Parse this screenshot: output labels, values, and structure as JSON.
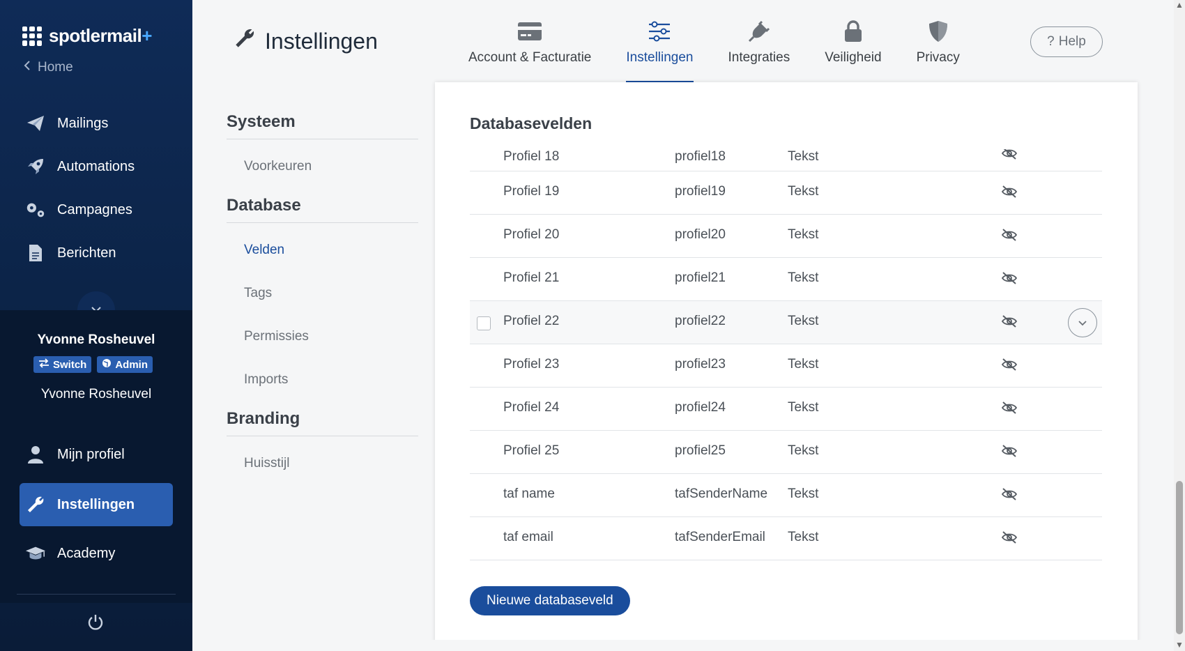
{
  "brand": {
    "name": "spotlermail",
    "plus": "+"
  },
  "home_link": "Home",
  "nav": {
    "items": [
      {
        "label": "Mailings",
        "icon": "paper-plane-icon"
      },
      {
        "label": "Automations",
        "icon": "rocket-icon"
      },
      {
        "label": "Campagnes",
        "icon": "gears-icon"
      },
      {
        "label": "Berichten",
        "icon": "document-icon"
      }
    ],
    "bottom_items": [
      {
        "label": "Mijn profiel",
        "icon": "user-icon"
      },
      {
        "label": "Instellingen",
        "icon": "wrench-icon",
        "active": true
      },
      {
        "label": "Academy",
        "icon": "graduation-cap-icon"
      }
    ]
  },
  "user": {
    "name": "Yvonne Rosheuvel",
    "switch_label": "Switch",
    "admin_label": "Admin",
    "account_name": "Yvonne Rosheuvel"
  },
  "header": {
    "title": "Instellingen",
    "tabs": [
      {
        "label": "Account & Facturatie",
        "icon": "credit-card-icon"
      },
      {
        "label": "Instellingen",
        "icon": "sliders-icon",
        "active": true
      },
      {
        "label": "Integraties",
        "icon": "plug-icon"
      },
      {
        "label": "Veiligheid",
        "icon": "lock-icon"
      },
      {
        "label": "Privacy",
        "icon": "shield-icon"
      }
    ],
    "help_label": "Help"
  },
  "submenu": {
    "sections": [
      {
        "title": "Systeem",
        "items": [
          "Voorkeuren"
        ]
      },
      {
        "title": "Database",
        "items": [
          "Velden",
          "Tags",
          "Permissies",
          "Imports"
        ],
        "active": "Velden"
      },
      {
        "title": "Branding",
        "items": [
          "Huisstijl"
        ]
      }
    ]
  },
  "panel": {
    "title": "Databasevelden",
    "rows": [
      {
        "label": "Profiel 18",
        "key": "profiel18",
        "type": "Tekst"
      },
      {
        "label": "Profiel 19",
        "key": "profiel19",
        "type": "Tekst"
      },
      {
        "label": "Profiel 20",
        "key": "profiel20",
        "type": "Tekst"
      },
      {
        "label": "Profiel 21",
        "key": "profiel21",
        "type": "Tekst"
      },
      {
        "label": "Profiel 22",
        "key": "profiel22",
        "type": "Tekst",
        "hover": true
      },
      {
        "label": "Profiel 23",
        "key": "profiel23",
        "type": "Tekst"
      },
      {
        "label": "Profiel 24",
        "key": "profiel24",
        "type": "Tekst"
      },
      {
        "label": "Profiel 25",
        "key": "profiel25",
        "type": "Tekst"
      },
      {
        "label": "taf name",
        "key": "tafSenderName",
        "type": "Tekst"
      },
      {
        "label": "taf email",
        "key": "tafSenderEmail",
        "type": "Tekst"
      }
    ],
    "new_button": "Nieuwe databaseveld"
  },
  "colors": {
    "sidebar_bg": "#0f2b57",
    "accent": "#1a4d9c",
    "active_nav": "#2a5eb0"
  }
}
